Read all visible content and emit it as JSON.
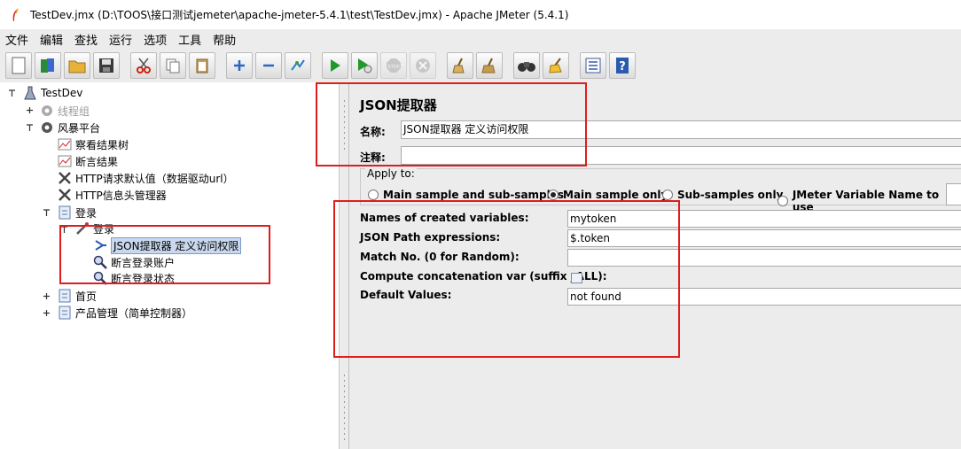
{
  "window": {
    "title": "TestDev.jmx (D:\\TOOS\\接口测试jemeter\\apache-jmeter-5.4.1\\test\\TestDev.jmx) - Apache JMeter (5.4.1)"
  },
  "menu": [
    "文件",
    "编辑",
    "查找",
    "运行",
    "选项",
    "工具",
    "帮助"
  ],
  "tree": {
    "root": "TestDev",
    "thread_group": "线程组",
    "platform": "风暴平台",
    "view_results": "察看结果树",
    "assert_results": "断言结果",
    "http_defaults": "HTTP请求默认值（数据驱动url）",
    "http_header": "HTTP信息头管理器",
    "login_ctrl": "登录",
    "login_sampler": "登录",
    "json_extractor": "JSON提取器 定义访问权限",
    "assert_account": "断言登录账户",
    "assert_status": "断言登录状态",
    "home": "首页",
    "product": "产品管理（简单控制器）"
  },
  "panel": {
    "title": "JSON提取器",
    "name_label": "名称:",
    "name_value": "JSON提取器 定义访问权限",
    "comment_label": "注释:",
    "comment_value": "",
    "apply_to": "Apply to:",
    "radios": [
      "Main sample and sub-samples",
      "Main sample only",
      "Sub-samples only",
      "JMeter Variable Name to use"
    ],
    "selected_radio": "Main sample only",
    "fields": {
      "names_label": "Names of created variables:",
      "names_value": "mytoken",
      "path_label": "JSON Path expressions:",
      "path_value": "$.token",
      "match_label": "Match No. (0 for Random):",
      "match_value": "",
      "concat_label": "Compute concatenation var (suffix _ALL):",
      "default_label": "Default Values:",
      "default_value": "not found"
    }
  },
  "colors": {
    "highlight": "#e01c1c",
    "selection": "#c9d8ee"
  }
}
